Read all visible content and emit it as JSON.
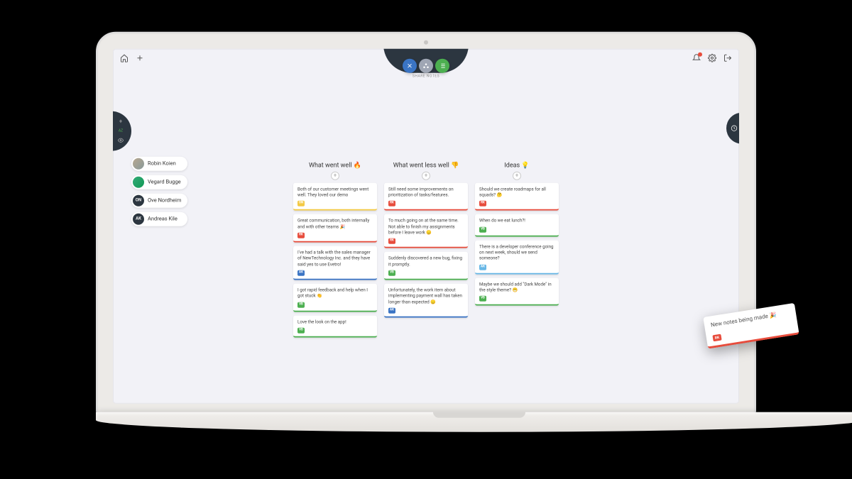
{
  "topbar": {
    "share_label": "SHARE NOTES"
  },
  "participants": [
    {
      "name": "Robin Koien",
      "initials": "RK",
      "avatar_style": "av-img"
    },
    {
      "name": "Vegard Bugge",
      "initials": "VB",
      "avatar_style": "av-green"
    },
    {
      "name": "Ove Nordheim",
      "initials": "ON",
      "avatar_style": "av-dark"
    },
    {
      "name": "Andreas Kile",
      "initials": "AK",
      "avatar_style": "av-dark"
    }
  ],
  "columns": [
    {
      "title": "What went well 🔥",
      "cards": [
        {
          "text": "Both of our customer meetings went well. They loved our demo",
          "initials": "ON",
          "border": "bc-yellow",
          "badge": "bg-yellow"
        },
        {
          "text": "Great communication, both internally and with other teams 🎉",
          "initials": "RK",
          "border": "bc-red",
          "badge": "bg-red"
        },
        {
          "text": "I've had a talk with the sales manager of NewTechnology Inc. and they have said yes to use Evetro!",
          "initials": "AK",
          "border": "bc-blue",
          "badge": "bg-blue"
        },
        {
          "text": "I got rapid feedback and help when I got stuck 👏",
          "initials": "VB",
          "border": "bc-green",
          "badge": "bg-green"
        },
        {
          "text": "Love the look on the app!",
          "initials": "VB",
          "border": "bc-green",
          "badge": "bg-green"
        }
      ]
    },
    {
      "title": "What went less well 👎",
      "cards": [
        {
          "text": "Still need some improvements on prioritization of tasks/features.",
          "initials": "RK",
          "border": "bc-red",
          "badge": "bg-red"
        },
        {
          "text": "To much going on at the same time. Not able to finish my assignments before I leave work 😞",
          "initials": "RK",
          "border": "bc-red",
          "badge": "bg-red"
        },
        {
          "text": "Suddenly discovered a new bug, fixing it promptly.",
          "initials": "VB",
          "border": "bc-green",
          "badge": "bg-green"
        },
        {
          "text": "Unfortunately, the work item about implementing payment wall has taken longer than expected 😞",
          "initials": "AK",
          "border": "bc-blue",
          "badge": "bg-blue"
        }
      ]
    },
    {
      "title": "Ideas 💡",
      "cards": [
        {
          "text": "Should we create roadmaps for all squads? 🤔",
          "initials": "RK",
          "border": "bc-red",
          "badge": "bg-red"
        },
        {
          "text": "When do we eat lunch?!",
          "initials": "VB",
          "border": "bc-green",
          "badge": "bg-green"
        },
        {
          "text": "There is a developer conference going on next week, should we send someone?",
          "initials": "AK",
          "border": "bc-ltblue",
          "badge": "bg-ltblue"
        },
        {
          "text": "Maybe we should add \"Dark Mode\" in the style theme? 😁",
          "initials": "VB",
          "border": "bc-green",
          "badge": "bg-green"
        }
      ]
    }
  ],
  "floating_note": {
    "text": "New notes being made 🎉",
    "initials": "RK"
  }
}
